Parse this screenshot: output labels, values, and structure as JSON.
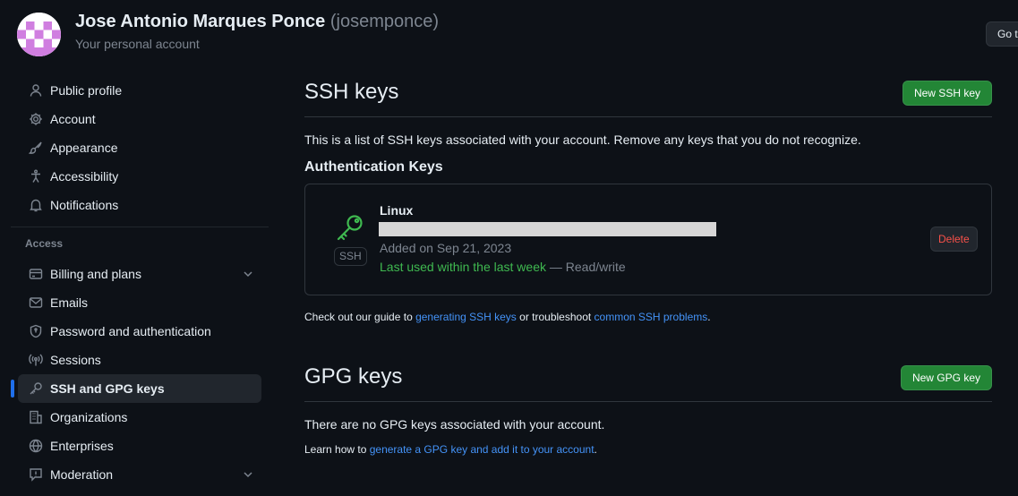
{
  "header": {
    "name": "Jose Antonio Marques Ponce",
    "login": "(josemponce)",
    "subtitle": "Your personal account",
    "goto_label": "Go to your personal profile"
  },
  "sidebar": {
    "items_top": [
      {
        "label": "Public profile",
        "icon": "person-icon"
      },
      {
        "label": "Account",
        "icon": "gear-icon"
      },
      {
        "label": "Appearance",
        "icon": "paintbrush-icon"
      },
      {
        "label": "Accessibility",
        "icon": "accessibility-icon"
      },
      {
        "label": "Notifications",
        "icon": "bell-icon"
      }
    ],
    "access_heading": "Access",
    "items_access": [
      {
        "label": "Billing and plans",
        "icon": "credit-card-icon"
      },
      {
        "label": "Emails",
        "icon": "mail-icon"
      },
      {
        "label": "Password and authentication",
        "icon": "shield-lock-icon"
      },
      {
        "label": "Sessions",
        "icon": "broadcast-icon"
      },
      {
        "label": "SSH and GPG keys",
        "icon": "key-icon"
      },
      {
        "label": "Organizations",
        "icon": "organization-icon"
      },
      {
        "label": "Enterprises",
        "icon": "globe-icon"
      },
      {
        "label": "Moderation",
        "icon": "report-icon"
      }
    ]
  },
  "ssh": {
    "title": "SSH keys",
    "new_button": "New SSH key",
    "intro": "This is a list of SSH keys associated with your account. Remove any keys that you do not recognize.",
    "auth_heading": "Authentication Keys",
    "key": {
      "name": "Linux",
      "badge": "SSH",
      "added": "Added on Sep 21, 2023",
      "last_used": "Last used within the last week",
      "access": " — Read/write",
      "delete_label": "Delete"
    },
    "guide": {
      "prefix": "Check out our guide to ",
      "link1": "generating SSH keys",
      "middle": " or troubleshoot ",
      "link2": "common SSH problems",
      "suffix": "."
    }
  },
  "gpg": {
    "title": "GPG keys",
    "new_button": "New GPG key",
    "none": "There are no GPG keys associated with your account.",
    "learn": {
      "prefix": "Learn how to ",
      "link": "generate a GPG key and add it to your account",
      "suffix": "."
    }
  },
  "colors": {
    "background": "#0d1117",
    "accent": "#1f6feb",
    "success": "#3fb950",
    "button_green": "#238636",
    "danger": "#f85149",
    "link": "#4493f8"
  }
}
